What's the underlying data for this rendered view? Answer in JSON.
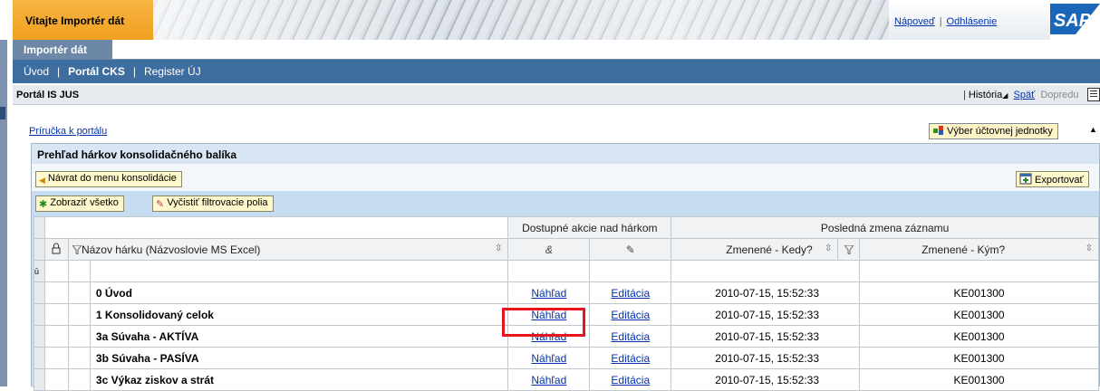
{
  "header": {
    "welcome": "Vitajte Importér dát",
    "help_link": "Nápoveď",
    "logout_link": "Odhlásenie",
    "logo_text": "SAP"
  },
  "tabs": {
    "active": "Importér dát"
  },
  "nav": {
    "items": [
      "Úvod",
      "Portál CKS",
      "Register ÚJ"
    ]
  },
  "page": {
    "title": "Portál IS JUS",
    "history": "História",
    "back": "Späť",
    "forward": "Dopredu"
  },
  "content": {
    "guide_link": "Príručka k portálu",
    "unit_select_button": "Výber účtovnej jednotky",
    "panel_title": "Prehľad hárkov konsolidačného balíka",
    "return_button": "Návrat do menu konsolidácie",
    "export_button": "Exportovať",
    "show_all_button": "Zobraziť všetko",
    "clear_filter_button": "Vyčistiť filtrovacie polia"
  },
  "grid": {
    "group_actions": "Dostupné akcie nad hárkom",
    "group_last_change": "Posledná zmena záznamu",
    "col_name": "Názov hárku (Názvoslovie MS Excel)",
    "col_changed_when": "Zmenené - Kedy?",
    "col_changed_by": "Zmenené - Kým?",
    "rows": [
      {
        "name": "0 Úvod",
        "preview": "Náhľad",
        "edit": "Editácia",
        "when": "2010-07-15, 15:52:33",
        "who": "KE001300"
      },
      {
        "name": "1 Konsolidovaný celok",
        "preview": "Náhľad",
        "edit": "Editácia",
        "when": "2010-07-15, 15:52:33",
        "who": "KE001300"
      },
      {
        "name": "3a Súvaha - AKTÍVA",
        "preview": "Náhľad",
        "edit": "Editácia",
        "when": "2010-07-15, 15:52:33",
        "who": "KE001300"
      },
      {
        "name": "3b Súvaha - PASÍVA",
        "preview": "Náhľad",
        "edit": "Editácia",
        "when": "2010-07-15, 15:52:33",
        "who": "KE001300"
      },
      {
        "name": "3c Výkaz ziskov a strát",
        "preview": "Náhľad",
        "edit": "Editácia",
        "when": "2010-07-15, 15:52:33",
        "who": "KE001300"
      }
    ]
  },
  "colors": {
    "welcome_orange": "#f0a020",
    "nav_blue": "#3e6ea0",
    "panel_header": "#d8e6f4",
    "highlight_red": "#e8141c"
  }
}
